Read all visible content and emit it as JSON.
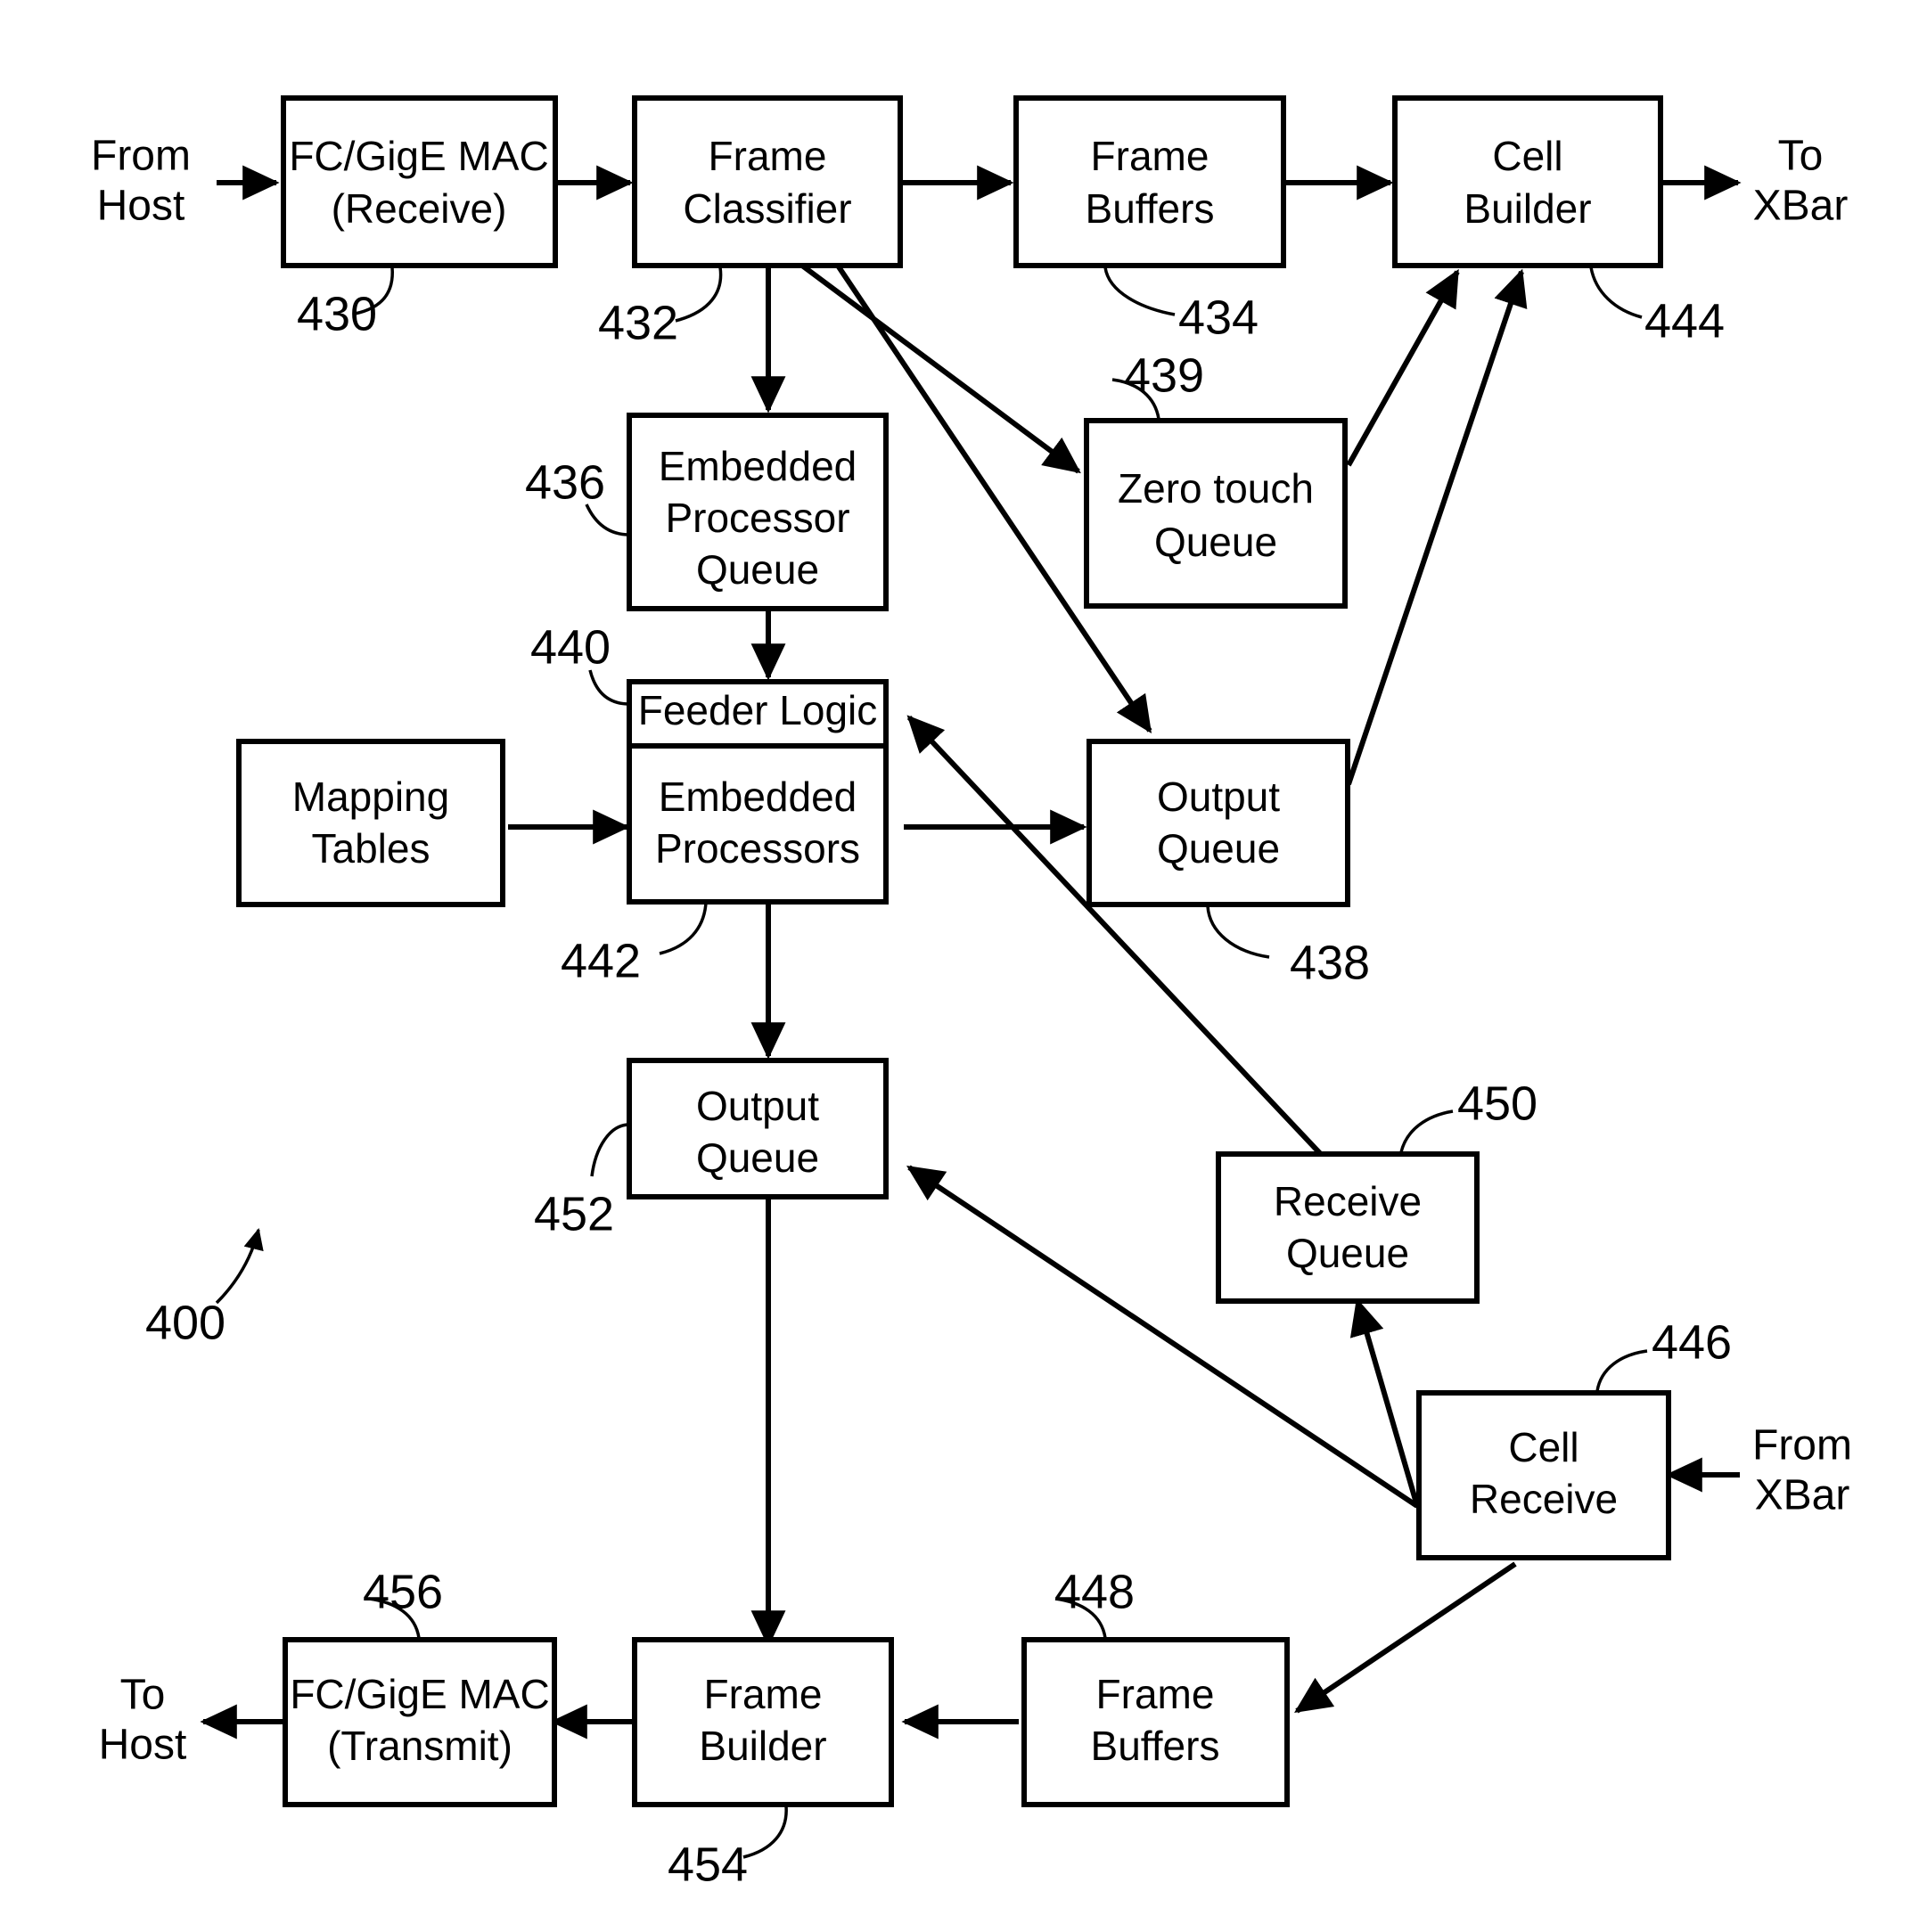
{
  "figure": {
    "figure_ref": "400",
    "boxes": [
      {
        "id": "b430",
        "ref": "430",
        "lines": [
          "FC/GigE MAC",
          "(Receive)"
        ]
      },
      {
        "id": "b432",
        "ref": "432",
        "lines": [
          "Frame",
          "Classifier"
        ]
      },
      {
        "id": "b434",
        "ref": "434",
        "lines": [
          "Frame",
          "Buffers"
        ]
      },
      {
        "id": "b444",
        "ref": "444",
        "lines": [
          "Cell",
          "Builder"
        ]
      },
      {
        "id": "b436",
        "ref": "436",
        "lines": [
          "Embedded",
          "Processor",
          "Queue"
        ]
      },
      {
        "id": "b439",
        "ref": "439",
        "lines": [
          "Zero touch",
          "Queue"
        ]
      },
      {
        "id": "b440",
        "ref": "440",
        "lines": [
          "Feeder Logic"
        ]
      },
      {
        "id": "b442",
        "ref": "442",
        "lines": [
          "Embedded",
          "Processors"
        ]
      },
      {
        "id": "bmap",
        "ref": "",
        "lines": [
          "Mapping",
          "Tables"
        ]
      },
      {
        "id": "b438",
        "ref": "438",
        "lines": [
          "Output",
          "Queue"
        ]
      },
      {
        "id": "b452",
        "ref": "452",
        "lines": [
          "Output",
          "Queue"
        ]
      },
      {
        "id": "b450",
        "ref": "450",
        "lines": [
          "Receive",
          "Queue"
        ]
      },
      {
        "id": "b446",
        "ref": "446",
        "lines": [
          "Cell",
          "Receive"
        ]
      },
      {
        "id": "b448",
        "ref": "448",
        "lines": [
          "Frame",
          "Buffers"
        ]
      },
      {
        "id": "b454",
        "ref": "454",
        "lines": [
          "Frame",
          "Builder"
        ]
      },
      {
        "id": "b456",
        "ref": "456",
        "lines": [
          "FC/GigE MAC",
          "(Transmit)"
        ]
      }
    ],
    "io_labels": [
      {
        "id": "io_from_host",
        "lines": [
          "From",
          "Host"
        ]
      },
      {
        "id": "io_to_xbar",
        "lines": [
          "To",
          "XBar"
        ]
      },
      {
        "id": "io_from_xbar",
        "lines": [
          "From",
          "XBar"
        ]
      },
      {
        "id": "io_to_host",
        "lines": [
          "To",
          "Host"
        ]
      }
    ],
    "ref_numbers": [
      "430",
      "432",
      "434",
      "444",
      "436",
      "439",
      "440",
      "442",
      "438",
      "452",
      "450",
      "446",
      "448",
      "454",
      "456",
      "400"
    ],
    "colors": {
      "stroke": "#000000",
      "fill": "#ffffff",
      "background": "#ffffff"
    }
  }
}
